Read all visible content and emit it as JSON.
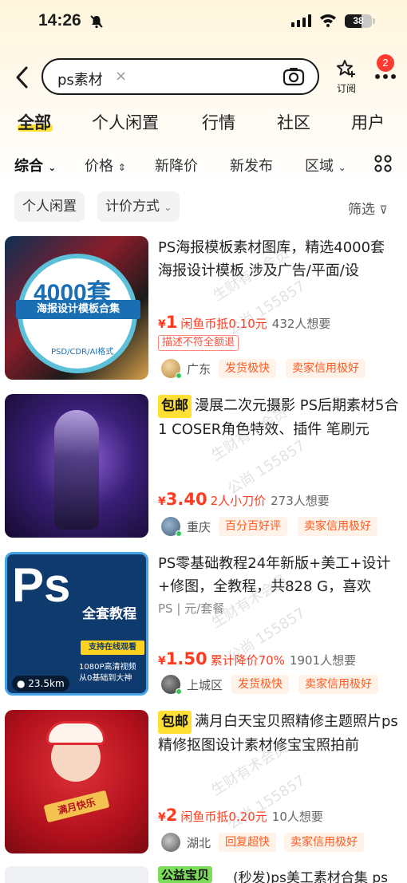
{
  "status_bar": {
    "time": "14:26",
    "battery": "38"
  },
  "search": {
    "query": "ps素材",
    "subscribe_label": "订阅",
    "badge_count": "2"
  },
  "tabs": [
    "全部",
    "个人闲置",
    "行情",
    "社区",
    "用户"
  ],
  "sort": [
    "综合",
    "价格",
    "新降价",
    "新发布",
    "区域"
  ],
  "chips": [
    "个人闲置",
    "计价方式"
  ],
  "filter_label": "筛选",
  "products": [
    {
      "title": "PS海报模板素材图库，精选4000套海报设计模板 涉及广告/平面/设",
      "baoyou": "",
      "spec": "",
      "price_symbol": "¥",
      "price": "1",
      "promo": "闲鱼币抵0.10元",
      "want": "432人想要",
      "outline_tag": "描述不符全额退",
      "city": "广东",
      "seller_tags": [
        "发货极快",
        "卖家信用极好"
      ],
      "thumb_text": [
        "4000套",
        "海报设计模板合集",
        "PSD/CDR/AI格式"
      ]
    },
    {
      "title": "漫展二次元摄影 PS后期素材5合1 COSER角色特效、插件 笔刷元",
      "baoyou": "包邮",
      "spec": "",
      "price_symbol": "¥",
      "price": "3.40",
      "promo": "2人小刀价",
      "want": "273人想要",
      "outline_tag": "",
      "city": "重庆",
      "seller_tags": [
        "百分百好评",
        "卖家信用极好"
      ],
      "thumb_text": []
    },
    {
      "title": "PS零基础教程24年新版+美工+设计+修图，全教程，共828 G，喜欢",
      "baoyou": "",
      "spec": "PS | 元/套餐",
      "price_symbol": "¥",
      "price": "1.50",
      "promo": "累计降价70%",
      "want": "1901人想要",
      "outline_tag": "",
      "city": "上城区",
      "seller_tags": [
        "发货极快",
        "卖家信用极好"
      ],
      "thumb_text": [
        "Ps",
        "全套教程",
        "支持在线观看",
        "1080P高清视频",
        "从0基础到大神",
        "23.5km"
      ]
    },
    {
      "title": "满月白天宝贝照精修主题照片ps精修抠图设计素材修宝宝照拍前",
      "baoyou": "包邮",
      "spec": "",
      "price_symbol": "¥",
      "price": "2",
      "promo": "闲鱼币抵0.20元",
      "want": "10人想要",
      "outline_tag": "",
      "city": "湖北",
      "seller_tags": [
        "回复超快",
        "卖家信用极好"
      ],
      "thumb_text": [
        "满月快乐"
      ]
    }
  ],
  "peek": {
    "tag": "公益宝贝",
    "title": "(秒发)ps美工素材合集 ps"
  },
  "watermark": [
    "生财有术会员",
    "公尚 155857"
  ],
  "colors": {
    "accent_yellow": "#ffe033",
    "price_red": "#ff3b1f",
    "badge_red": "#ff3b30"
  }
}
